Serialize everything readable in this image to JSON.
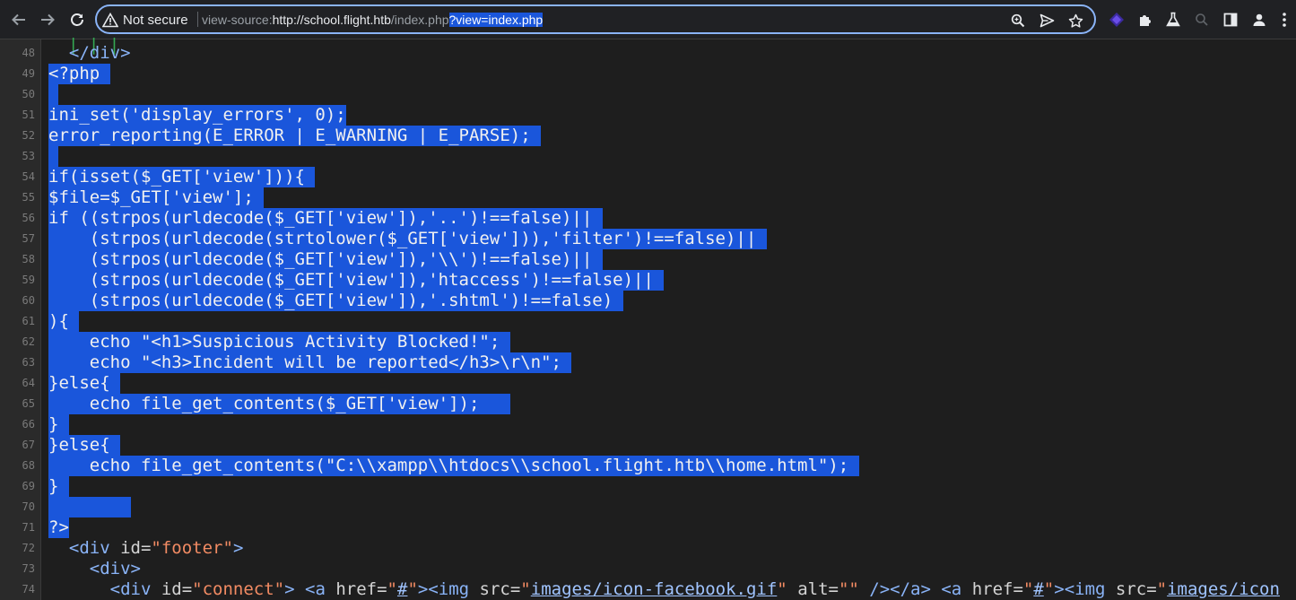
{
  "toolbar": {
    "security_label": "Not secure",
    "url_prefix": "view-source:",
    "url_host": "http://school.flight.htb",
    "url_path": "/index.php",
    "url_selected": "?view=index.php",
    "icons": [
      "back-icon",
      "forward-icon",
      "reload-icon",
      "warning-icon",
      "zoom-icon",
      "send-icon",
      "star-icon",
      "extension-icon",
      "puzzle-icon",
      "flask-icon",
      "search-icon",
      "sidepanel-icon",
      "profile-icon",
      "menu-icon"
    ]
  },
  "source": {
    "top_fragment": "| | |",
    "lines": [
      {
        "n": "48",
        "text": "  </div>"
      },
      {
        "n": "49",
        "text": "<?php "
      },
      {
        "n": "50",
        "text": " "
      },
      {
        "n": "51",
        "text": "ini_set('display_errors', 0);"
      },
      {
        "n": "52",
        "text": "error_reporting(E_ERROR | E_WARNING | E_PARSE); "
      },
      {
        "n": "53",
        "text": " "
      },
      {
        "n": "54",
        "text": "if(isset($_GET['view'])){ "
      },
      {
        "n": "55",
        "text": "$file=$_GET['view']; "
      },
      {
        "n": "56",
        "text": "if ((strpos(urldecode($_GET['view']),'..')!==false)|| "
      },
      {
        "n": "57",
        "text": "    (strpos(urldecode(strtolower($_GET['view'])),'filter')!==false)|| "
      },
      {
        "n": "58",
        "text": "    (strpos(urldecode($_GET['view']),'\\\\')!==false)|| "
      },
      {
        "n": "59",
        "text": "    (strpos(urldecode($_GET['view']),'htaccess')!==false)|| "
      },
      {
        "n": "60",
        "text": "    (strpos(urldecode($_GET['view']),'.shtml')!==false) "
      },
      {
        "n": "61",
        "text": "){ "
      },
      {
        "n": "62",
        "text": "    echo \"<h1>Suspicious Activity Blocked!\"; "
      },
      {
        "n": "63",
        "text": "    echo \"<h3>Incident will be reported</h3>\\r\\n\"; "
      },
      {
        "n": "64",
        "text": "}else{ "
      },
      {
        "n": "65",
        "text": "    echo file_get_contents($_GET['view']);   "
      },
      {
        "n": "66",
        "text": "} "
      },
      {
        "n": "67",
        "text": "}else{ "
      },
      {
        "n": "68",
        "text": "    echo file_get_contents(\"C:\\\\xampp\\\\htdocs\\\\school.flight.htb\\\\home.html\"); "
      },
      {
        "n": "69",
        "text": "} "
      },
      {
        "n": "70",
        "text": "        "
      },
      {
        "n": "71",
        "text": "?>"
      }
    ],
    "line72": {
      "n": "72",
      "indent": "  ",
      "tag_open": "<div ",
      "attr": "id=",
      "val": "\"footer\"",
      "tag_close": ">"
    },
    "line73": {
      "n": "73",
      "indent": "    ",
      "tag": "<div>"
    },
    "line74": {
      "n": "74",
      "indent": "      ",
      "t1": "<div ",
      "a1": "id=",
      "v1": "\"connect\"",
      "t2": "> <a ",
      "a2": "href=",
      "q1": "\"",
      "l1": "#",
      "q2": "\"",
      "t3": "><img ",
      "a3": "src=",
      "q3": "\"",
      "l2": "images/icon-facebook.gif",
      "q4": "\"",
      "a4": " alt=",
      "v4": "\"\"",
      "t4": " /></a> <a ",
      "a5": "href=",
      "q5": "\"",
      "l3": "#",
      "q6": "\"",
      "t5": "><img ",
      "a6": "src=",
      "q7": "\"",
      "l4": "images/icon"
    }
  }
}
